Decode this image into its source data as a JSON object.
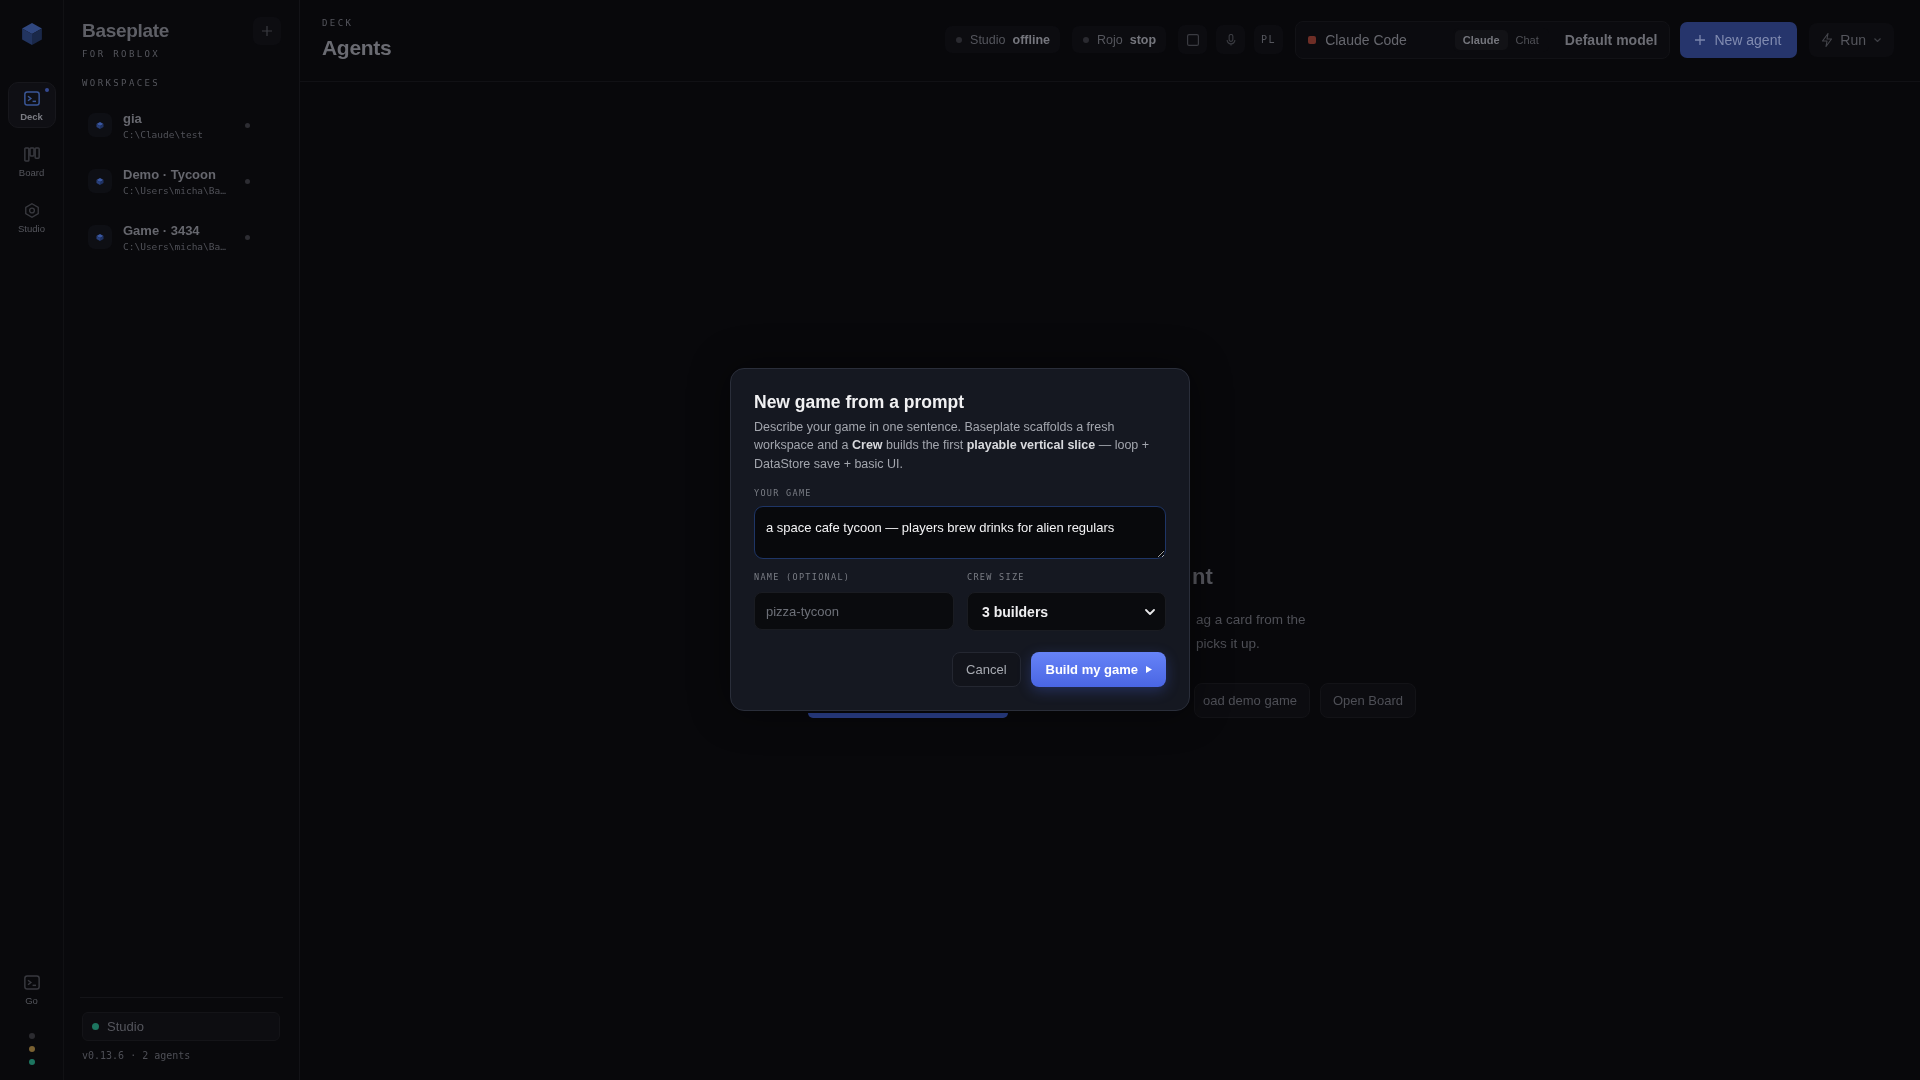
{
  "rail": {
    "items": [
      {
        "label": "Deck",
        "selected": true,
        "notification": true
      },
      {
        "label": "Board",
        "selected": false,
        "notification": false
      },
      {
        "label": "Studio",
        "selected": false,
        "notification": false
      }
    ],
    "go": {
      "label": "Go"
    },
    "status_dots": [
      {
        "color": "#2b2b30"
      },
      {
        "color": "#7a6132"
      },
      {
        "color": "#1d7560"
      }
    ]
  },
  "sidebar": {
    "title": "Baseplate",
    "subtitle": "FOR ROBLOX",
    "section": "WORKSPACES",
    "workspaces": [
      {
        "name": "gia",
        "path": "C:\\Claude\\test"
      },
      {
        "name": "Demo · Tycoon",
        "path": "C:\\Users\\micha\\Ba…"
      },
      {
        "name": "Game · 3434",
        "path": "C:\\Users\\micha\\Ba…"
      }
    ],
    "studio": {
      "label": "Studio"
    },
    "footer": "v0.13.6 · 2 agents"
  },
  "header": {
    "eyebrow": "DECK",
    "title": "Agents"
  },
  "toolbar": {
    "chips": [
      {
        "label": "Studio",
        "value": "offline"
      },
      {
        "label": "Rojo",
        "value": "stop"
      }
    ],
    "pl_button": "PL",
    "agent": {
      "name": "Claude Code",
      "modes": [
        {
          "label": "Claude",
          "selected": true
        },
        {
          "label": "Chat",
          "selected": false
        }
      ],
      "model": "Default model"
    },
    "new_agent": "New agent",
    "run": "Run"
  },
  "empty_state": {
    "heading": "nt",
    "lines": [
      "ag a card from the",
      "picks it up."
    ],
    "buttons": [
      {
        "label": "oad demo game"
      },
      {
        "label": "Open Board"
      }
    ]
  },
  "dialog": {
    "title": "New game from a prompt",
    "description": "Describe your game in one sentence. Baseplate scaffolds a fresh workspace and a **Crew** builds the first **playable vertical slice** — loop + DataStore save + basic UI.",
    "prompt": {
      "label": "YOUR GAME",
      "value": "a space cafe tycoon — players brew drinks for alien regulars"
    },
    "name": {
      "label": "NAME (OPTIONAL)",
      "placeholder": "pizza-tycoon"
    },
    "crew": {
      "label": "CREW SIZE",
      "value": "3 builders"
    },
    "cancel": "Cancel",
    "submit": "Build my game"
  }
}
